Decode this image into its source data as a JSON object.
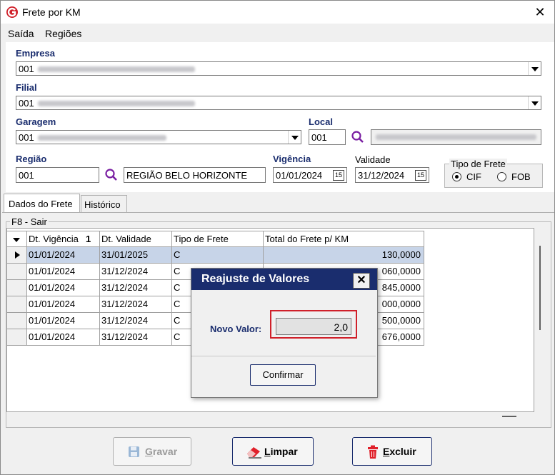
{
  "window": {
    "title": "Frete por KM",
    "close_glyph": "✕"
  },
  "menu": {
    "items": [
      "Saída",
      "Regiões"
    ]
  },
  "form": {
    "empresa": {
      "label": "Empresa",
      "value": "001"
    },
    "filial": {
      "label": "Filial",
      "value": "001"
    },
    "garagem": {
      "label": "Garagem",
      "value": "001"
    },
    "local": {
      "label": "Local",
      "value": "001"
    },
    "regiao": {
      "label": "Região",
      "code": "001",
      "name": "REGIÃO BELO HORIZONTE"
    },
    "vigencia": {
      "label": "Vigência",
      "value": "01/01/2024",
      "btn": "15"
    },
    "validade": {
      "label": "Validade",
      "value": "31/12/2024",
      "btn": "15"
    },
    "tipo_frete": {
      "label": "Tipo de Frete",
      "options": [
        "CIF",
        "FOB"
      ],
      "selected": "CIF"
    }
  },
  "tabs": [
    "Dados do Frete",
    "Histórico"
  ],
  "panel": {
    "hint": "F8 - Sair"
  },
  "grid": {
    "sort_indicator": "1",
    "columns": [
      "Dt. Vigência",
      "Dt. Validade",
      "Tipo de Frete",
      "Total do Frete p/ KM"
    ],
    "rows": [
      [
        "01/01/2024",
        "31/01/2025",
        "C",
        "130,0000"
      ],
      [
        "01/01/2024",
        "31/12/2024",
        "C",
        "060,0000"
      ],
      [
        "01/01/2024",
        "31/12/2024",
        "C",
        "845,0000"
      ],
      [
        "01/01/2024",
        "31/12/2024",
        "C",
        "000,0000"
      ],
      [
        "01/01/2024",
        "31/12/2024",
        "C",
        "500,0000"
      ],
      [
        "01/01/2024",
        "31/12/2024",
        "C",
        "676,0000"
      ]
    ]
  },
  "dialog": {
    "title": "Reajuste de Valores",
    "close_glyph": "✕",
    "field_label": "Novo Valor:",
    "field_value": "2,0",
    "confirm": "Confirmar"
  },
  "buttons": {
    "gravar": {
      "prefix": "G",
      "rest": "ravar"
    },
    "limpar": {
      "prefix": "L",
      "rest": "impar"
    },
    "excluir": {
      "prefix": "E",
      "rest": "xcluir"
    }
  },
  "colors": {
    "accent": "#1a2d6e",
    "highlight": "#d0202a",
    "selection": "#c7d4e8"
  }
}
